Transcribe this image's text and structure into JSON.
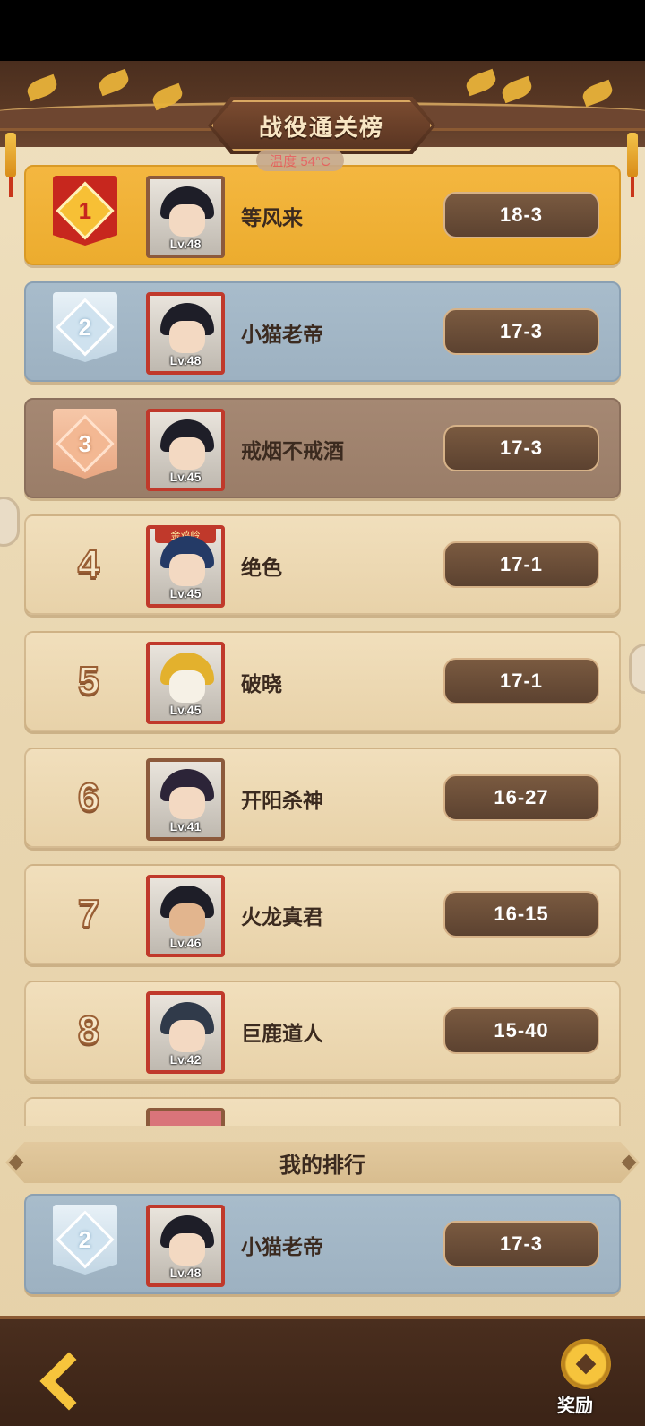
{
  "header": {
    "title": "战役通关榜",
    "temperature": "温度 54°C"
  },
  "rows": [
    {
      "rank": "1",
      "name": "等风来",
      "level": "Lv.48",
      "score": "18-3"
    },
    {
      "rank": "2",
      "name": "小猫老帝",
      "level": "Lv.48",
      "score": "17-3"
    },
    {
      "rank": "3",
      "name": "戒烟不戒酒",
      "level": "Lv.45",
      "score": "17-3"
    },
    {
      "rank": "4",
      "name": "绝色",
      "level": "Lv.45",
      "score": "17-1",
      "tag": "金鸡岭"
    },
    {
      "rank": "5",
      "name": "破晓",
      "level": "Lv.45",
      "score": "17-1"
    },
    {
      "rank": "6",
      "name": "开阳杀神",
      "level": "Lv.41",
      "score": "16-27"
    },
    {
      "rank": "7",
      "name": "火龙真君",
      "level": "Lv.46",
      "score": "16-15"
    },
    {
      "rank": "8",
      "name": "巨鹿道人",
      "level": "Lv.42",
      "score": "15-40"
    }
  ],
  "my_rank": {
    "header": "我的排行",
    "rank": "2",
    "name": "小猫老帝",
    "level": "Lv.48",
    "score": "17-3"
  },
  "footer": {
    "reward_label": "奖励"
  },
  "colors": {
    "gold": "#f4b740",
    "silver": "#a8bccb",
    "bronze": "#a58873",
    "score_bg": "#6b4c36"
  },
  "icons": [
    "back-arrow-icon",
    "reward-coin-icon",
    "rank-badge-icon"
  ]
}
